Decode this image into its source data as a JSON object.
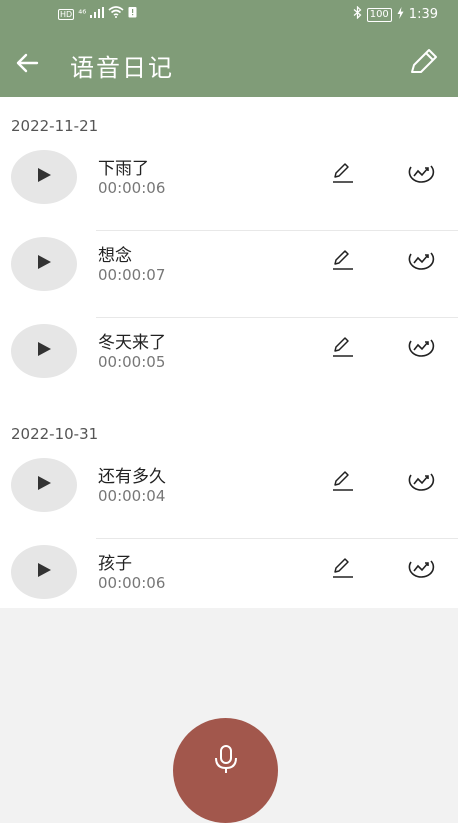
{
  "status_bar": {
    "hd_badge": "HD",
    "network": "⁴⁶",
    "battery": "100",
    "time": "1:39"
  },
  "header": {
    "title": "语音日记"
  },
  "groups": [
    {
      "date": "2022-11-21",
      "items": [
        {
          "title": "下雨了",
          "duration": "00:00:06"
        },
        {
          "title": "想念",
          "duration": "00:00:07"
        },
        {
          "title": "冬天来了",
          "duration": "00:00:05"
        }
      ]
    },
    {
      "date": "2022-10-31",
      "items": [
        {
          "title": "还有多久",
          "duration": "00:00:04"
        },
        {
          "title": "孩子",
          "duration": "00:00:06"
        }
      ]
    }
  ],
  "colors": {
    "header": "#809c78",
    "record_button": "#a2574c"
  },
  "icons": {
    "back": "arrow-left-icon",
    "edit_diary": "pencil-icon",
    "play": "play-icon",
    "item_edit": "edit-icon",
    "item_stats": "trend-icon",
    "record": "microphone-icon"
  }
}
